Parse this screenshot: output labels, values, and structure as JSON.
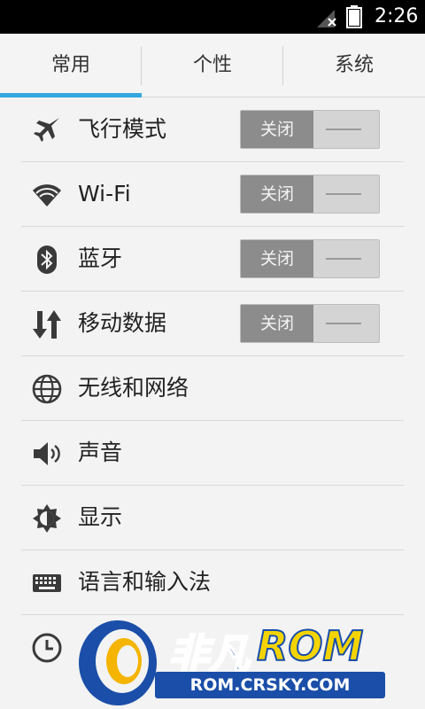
{
  "status_bar": {
    "time": "2:26",
    "signal_icon": "signal-no-service-icon",
    "battery_icon": "battery-full-icon"
  },
  "tabs": [
    {
      "label": "常用",
      "selected": true
    },
    {
      "label": "个性",
      "selected": false
    },
    {
      "label": "系统",
      "selected": false
    }
  ],
  "accent_color": "#33a7df",
  "settings": [
    {
      "label": "飞行模式",
      "icon": "airplane-icon",
      "toggle": "关闭"
    },
    {
      "label": "Wi-Fi",
      "icon": "wifi-icon",
      "toggle": "关闭"
    },
    {
      "label": "蓝牙",
      "icon": "bluetooth-icon",
      "toggle": "关闭"
    },
    {
      "label": "移动数据",
      "icon": "mobile-data-icon",
      "toggle": "关闭"
    },
    {
      "label": "无线和网络",
      "icon": "globe-icon"
    },
    {
      "label": "声音",
      "icon": "speaker-icon"
    },
    {
      "label": "显示",
      "icon": "brightness-icon"
    },
    {
      "label": "语言和输入法",
      "icon": "keyboard-icon"
    },
    {
      "label": "",
      "icon": "clock-icon"
    }
  ],
  "watermark": {
    "name_cn": "非凡",
    "name_en": "ROM",
    "url": "ROM.CRSKY.COM"
  }
}
